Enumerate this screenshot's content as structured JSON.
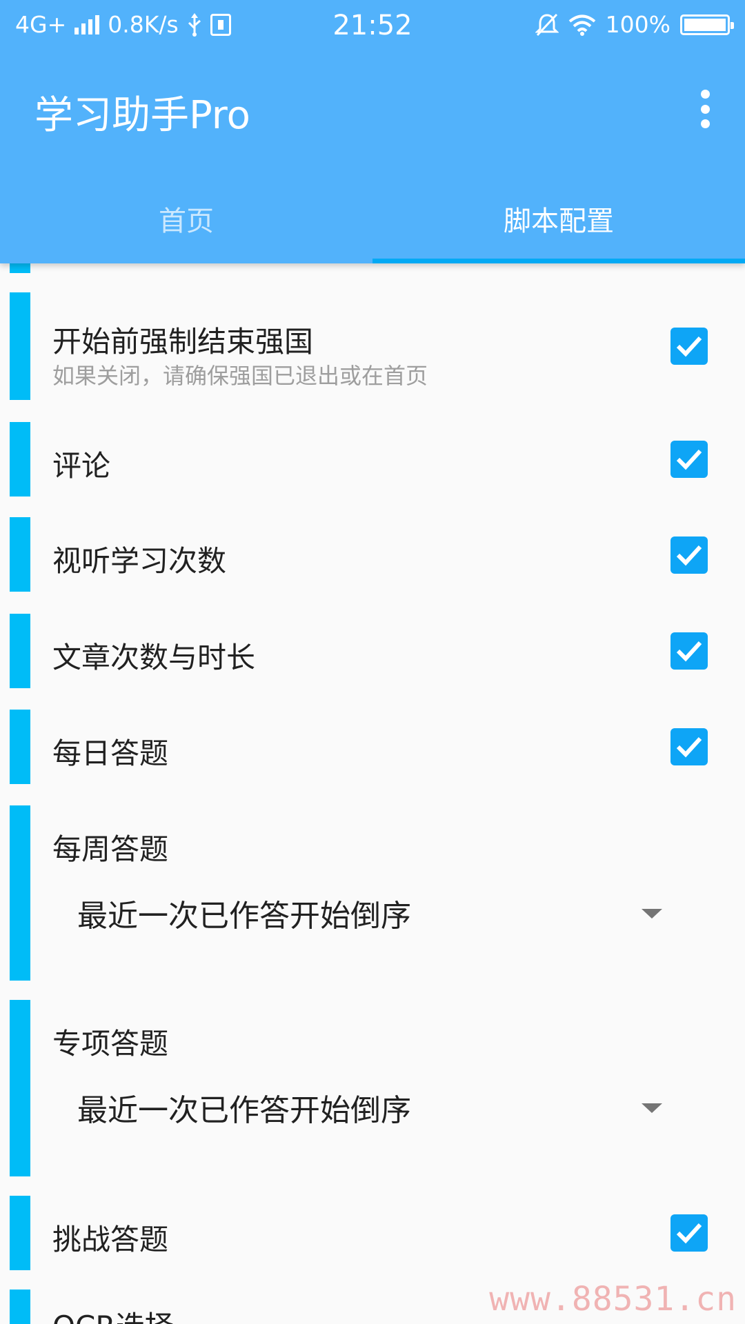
{
  "status_bar": {
    "network": "4G+",
    "speed": "0.8K/s",
    "time": "21:52",
    "battery": "100%"
  },
  "app_bar": {
    "title": "学习助手Pro"
  },
  "tabs": [
    {
      "label": "首页",
      "active": false
    },
    {
      "label": "脚本配置",
      "active": true
    }
  ],
  "settings": {
    "force_close": {
      "title": "开始前强制结束强国",
      "subtitle": "如果关闭，请确保强国已退出或在首页",
      "checked": true
    },
    "comment": {
      "title": "评论",
      "checked": true
    },
    "video_count": {
      "title": "视听学习次数",
      "checked": true
    },
    "article": {
      "title": "文章次数与时长",
      "checked": true
    },
    "daily_quiz": {
      "title": "每日答题",
      "checked": true
    },
    "weekly_quiz": {
      "title": "每周答题",
      "selected": "最近一次已作答开始倒序"
    },
    "special_quiz": {
      "title": "专项答题",
      "selected": "最近一次已作答开始倒序"
    },
    "challenge_quiz": {
      "title": "挑战答题",
      "checked": true
    },
    "ocr": {
      "title": "OCR选择"
    }
  },
  "watermark": "www.88531.cn",
  "colors": {
    "app_bar": "#52b2fb",
    "accent": "#00bcf7",
    "checkbox": "#0ea5f6",
    "tab_indicator": "#03a9f4"
  }
}
